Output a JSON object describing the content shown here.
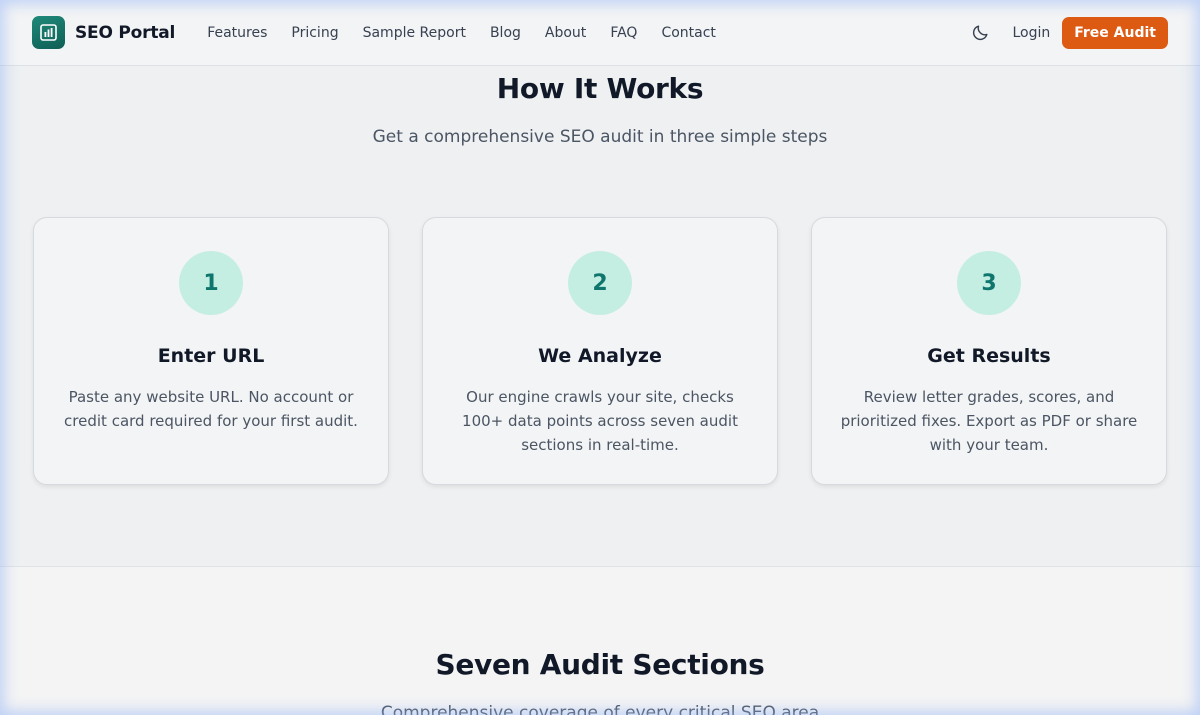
{
  "header": {
    "brand": "SEO Portal",
    "nav": [
      "Features",
      "Pricing",
      "Sample Report",
      "Blog",
      "About",
      "FAQ",
      "Contact"
    ],
    "login": "Login",
    "cta": "Free Audit",
    "theme_icon": "moon-icon",
    "logo_icon": "bar-chart-icon"
  },
  "how_it_works": {
    "title": "How It Works",
    "subtitle": "Get a comprehensive SEO audit in three simple steps",
    "steps": [
      {
        "number": "1",
        "title": "Enter URL",
        "description": "Paste any website URL. No account or credit card required for your first audit."
      },
      {
        "number": "2",
        "title": "We Analyze",
        "description": "Our engine crawls your site, checks 100+ data points across seven audit sections in real-time."
      },
      {
        "number": "3",
        "title": "Get Results",
        "description": "Review letter grades, scores, and prioritized fixes. Export as PDF or share with your team."
      }
    ]
  },
  "audit_sections": {
    "title": "Seven Audit Sections",
    "subtitle": "Comprehensive coverage of every critical SEO area"
  },
  "colors": {
    "accent": "#0f766e",
    "cta": "#dd5a12",
    "step_circle": "#c5eee3"
  }
}
